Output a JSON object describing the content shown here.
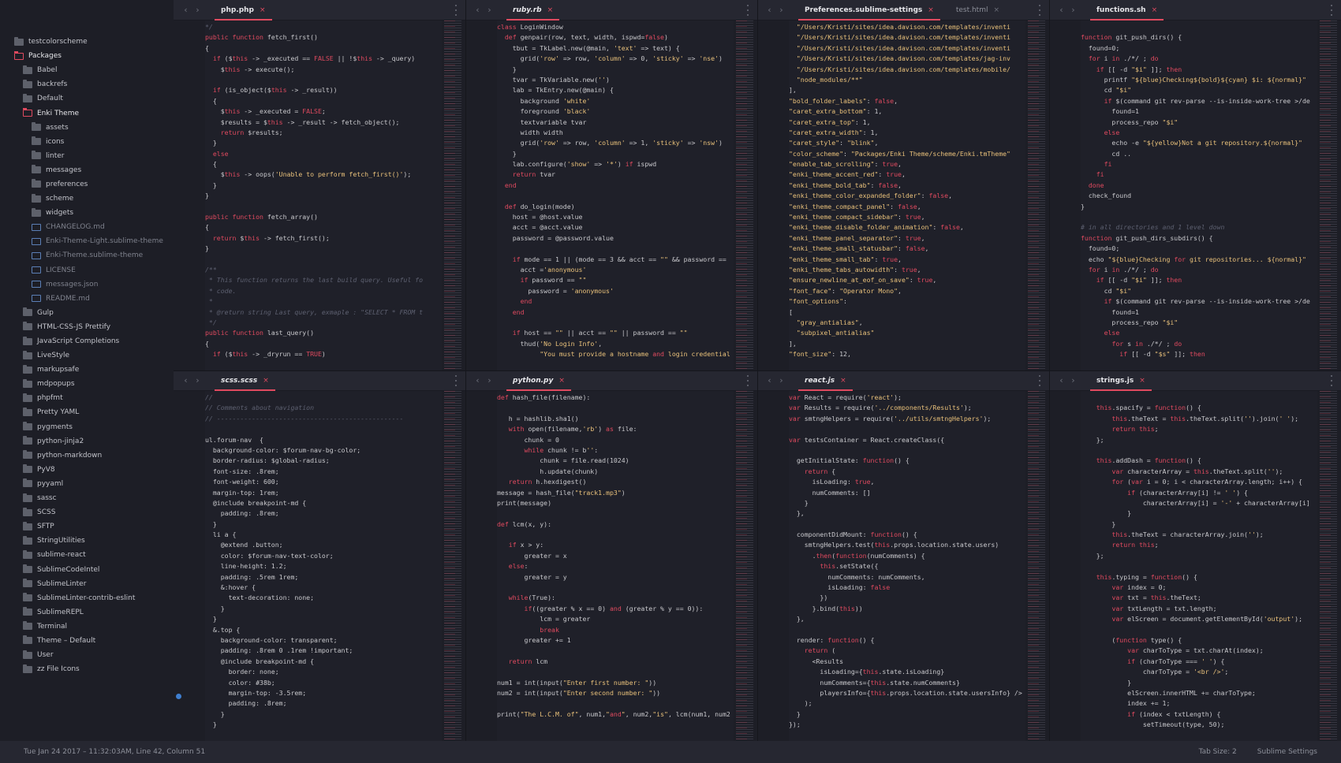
{
  "sidebar": {
    "items": [
      {
        "label": "testcolorscheme",
        "kind": "folder",
        "depth": 0
      },
      {
        "label": "Packages",
        "kind": "folder-open",
        "depth": 0
      },
      {
        "label": "Babel",
        "kind": "folder",
        "depth": 1
      },
      {
        "label": "backrefs",
        "kind": "folder",
        "depth": 1
      },
      {
        "label": "Default",
        "kind": "folder",
        "depth": 1
      },
      {
        "label": "Enki Theme",
        "kind": "folder-open",
        "depth": 1
      },
      {
        "label": "assets",
        "kind": "folder",
        "depth": 2
      },
      {
        "label": "icons",
        "kind": "folder",
        "depth": 2
      },
      {
        "label": "linter",
        "kind": "folder",
        "depth": 2
      },
      {
        "label": "messages",
        "kind": "folder",
        "depth": 2
      },
      {
        "label": "preferences",
        "kind": "folder",
        "depth": 2
      },
      {
        "label": "scheme",
        "kind": "folder",
        "depth": 2
      },
      {
        "label": "widgets",
        "kind": "folder",
        "depth": 2
      },
      {
        "label": "CHANGELOG.md",
        "kind": "file",
        "depth": 2
      },
      {
        "label": "Enki-Theme-Light.sublime-theme",
        "kind": "file",
        "depth": 2
      },
      {
        "label": "Enki-Theme.sublime-theme",
        "kind": "file",
        "depth": 2
      },
      {
        "label": "LICENSE",
        "kind": "file",
        "depth": 2
      },
      {
        "label": "messages.json",
        "kind": "file",
        "depth": 2
      },
      {
        "label": "README.md",
        "kind": "file",
        "depth": 2
      },
      {
        "label": "Gulp",
        "kind": "folder",
        "depth": 1
      },
      {
        "label": "HTML-CSS-JS Prettify",
        "kind": "folder",
        "depth": 1
      },
      {
        "label": "JavaScript Completions",
        "kind": "folder",
        "depth": 1
      },
      {
        "label": "LiveStyle",
        "kind": "folder",
        "depth": 1
      },
      {
        "label": "markupsafe",
        "kind": "folder",
        "depth": 1
      },
      {
        "label": "mdpopups",
        "kind": "folder",
        "depth": 1
      },
      {
        "label": "phpfmt",
        "kind": "folder",
        "depth": 1
      },
      {
        "label": "Pretty YAML",
        "kind": "folder",
        "depth": 1
      },
      {
        "label": "pygments",
        "kind": "folder",
        "depth": 1
      },
      {
        "label": "python-jinja2",
        "kind": "folder",
        "depth": 1
      },
      {
        "label": "python-markdown",
        "kind": "folder",
        "depth": 1
      },
      {
        "label": "PyV8",
        "kind": "folder",
        "depth": 1
      },
      {
        "label": "pyyaml",
        "kind": "folder",
        "depth": 1
      },
      {
        "label": "sassc",
        "kind": "folder",
        "depth": 1
      },
      {
        "label": "SCSS",
        "kind": "folder",
        "depth": 1
      },
      {
        "label": "SFTP",
        "kind": "folder",
        "depth": 1
      },
      {
        "label": "StringUtilities",
        "kind": "folder",
        "depth": 1
      },
      {
        "label": "sublime-react",
        "kind": "folder",
        "depth": 1
      },
      {
        "label": "SublimeCodeIntel",
        "kind": "folder",
        "depth": 1
      },
      {
        "label": "SublimeLinter",
        "kind": "folder",
        "depth": 1
      },
      {
        "label": "SublimeLinter-contrib-eslint",
        "kind": "folder",
        "depth": 1
      },
      {
        "label": "SublimeREPL",
        "kind": "folder",
        "depth": 1
      },
      {
        "label": "Terminal",
        "kind": "folder",
        "depth": 1
      },
      {
        "label": "Theme – Default",
        "kind": "folder",
        "depth": 1
      },
      {
        "label": "User",
        "kind": "folder",
        "depth": 1
      },
      {
        "label": "zz File Icons",
        "kind": "folder",
        "depth": 1
      }
    ]
  },
  "panes": [
    {
      "tabs": [
        {
          "label": "php.php",
          "active": true,
          "italic": false
        }
      ],
      "lines": [
        "*/",
        "public function fetch_first()",
        "{",
        "  if ($this -> _executed == FALSE || !$this -> _query)",
        "    $this -> execute();",
        "",
        "  if (is_object($this -> _result))",
        "  {",
        "    $this -> _executed = FALSE;",
        "    $results = $this -> _result -> fetch_object();",
        "    return $results;",
        "  }",
        "  else",
        "  {",
        "    $this -> oops('Unable to perform fetch_first()');",
        "  }",
        "}",
        "",
        "public function fetch_array()",
        "{",
        "  return $this -> fetch_first();",
        "}",
        "",
        "/**",
        " * This function returns the last build query. Useful fo",
        " * code.",
        " *",
        " * @return string Last query, exmaple : \"SELECT * FROM t",
        " */",
        "public function last_query()",
        "{",
        "  if ($this -> _dryrun == TRUE)"
      ]
    },
    {
      "tabs": [
        {
          "label": "ruby.rb",
          "active": true,
          "italic": true
        }
      ],
      "lines": [
        "class LoginWindow",
        "  def genpair(row, text, width, ispwd=false)",
        "    tbut = TkLabel.new(@main, 'text' => text) {",
        "      grid('row' => row, 'column' => 0, 'sticky' => 'nse')",
        "    }",
        "    tvar = TkVariable.new('')",
        "    lab = TkEntry.new(@main) {",
        "      background 'white'",
        "      foreground 'black'",
        "      textvariable tvar",
        "      width width",
        "      grid('row' => row, 'column' => 1, 'sticky' => 'nsw')",
        "    }",
        "    lab.configure('show' => '*') if ispwd",
        "    return tvar",
        "  end",
        "",
        "  def do_login(mode)",
        "    host = @host.value",
        "    acct = @acct.value",
        "    password = @password.value",
        "",
        "    if mode == 1 || (mode == 3 && acct == \"\" && password ==",
        "      acct ='anonymous'",
        "      if password == \"\"",
        "        password = 'anonymous'",
        "      end",
        "    end",
        "",
        "    if host == \"\" || acct == \"\" || password == \"\"",
        "      thud('No Login Info',",
        "           \"You must provide a hostname and login credential"
      ]
    },
    {
      "tabs": [
        {
          "label": "Preferences.sublime-settings",
          "active": true,
          "italic": false
        },
        {
          "label": "test.html",
          "active": false,
          "italic": false
        }
      ],
      "lines": [
        "  \"/Users/Kristi/sites/idea.davison.com/templates/inventi",
        "  \"/Users/Kristi/sites/idea.davison.com/templates/inventi",
        "  \"/Users/Kristi/sites/idea.davison.com/templates/inventi",
        "  \"/Users/Kristi/sites/idea.davison.com/templates/jag-inv",
        "  \"/Users/Kristi/sites/idea.davison.com/templates/mobile/",
        "  \"node_modules/**\"",
        "],",
        "\"bold_folder_labels\": false,",
        "\"caret_extra_bottom\": 1,",
        "\"caret_extra_top\": 1,",
        "\"caret_extra_width\": 1,",
        "\"caret_style\": \"blink\",",
        "\"color_scheme\": \"Packages/Enki Theme/scheme/Enki.tmTheme\"",
        "\"enable_tab_scrolling\": true,",
        "\"enki_theme_accent_red\": true,",
        "\"enki_theme_bold_tab\": false,",
        "\"enki_theme_color_expanded_folder\": false,",
        "\"enki_theme_compact_panel\": false,",
        "\"enki_theme_compact_sidebar\": true,",
        "\"enki_theme_disable_folder_animation\": false,",
        "\"enki_theme_panel_separator\": true,",
        "\"enki_theme_small_statusbar\": false,",
        "\"enki_theme_small_tab\": true,",
        "\"enki_theme_tabs_autowidth\": true,",
        "\"ensure_newline_at_eof_on_save\": true,",
        "\"font_face\": \"Operator Mono\",",
        "\"font_options\":",
        "[",
        "  \"gray_antialias\",",
        "  \"subpixel_antialias\"",
        "],",
        "\"font_size\": 12,"
      ]
    },
    {
      "tabs": [
        {
          "label": "functions.sh",
          "active": true,
          "italic": false
        }
      ],
      "lines": [
        "",
        "function git_push_dirs() {",
        "  found=0;",
        "  for i in ./*/ ; do",
        "    if [[ -d \"$i\" ]]; then",
        "      printf \"${blue}Checking${bold}${cyan} $i: ${normal}\"",
        "      cd \"$i\"",
        "      if $(command git rev-parse --is-inside-work-tree >/de",
        "        found=1",
        "        process_repo \"$i\"",
        "      else",
        "        echo -e \"${yellow}Not a git repository.${normal}\"",
        "        cd ..",
        "      fi",
        "    fi",
        "  done",
        "  check_found",
        "}",
        "",
        "# in all directories and 1 level down",
        "function git_push_dirs_subdirs() {",
        "  found=0;",
        "  echo \"${blue}Checking for git repositories... ${normal}\"",
        "  for i in ./*/ ; do",
        "    if [[ -d \"$i\" ]]; then",
        "      cd \"$i\"",
        "      if $(command git rev-parse --is-inside-work-tree >/de",
        "        found=1",
        "        process_repo \"$i\"",
        "      else",
        "        for s in ./*/ ; do",
        "          if [[ -d \"$s\" ]]; then"
      ]
    },
    {
      "tabs": [
        {
          "label": "scss.scss",
          "active": true,
          "italic": true
        }
      ],
      "lines": [
        "//",
        "// Comments about navigation",
        "// ------------------------------------------------",
        "",
        "ul.forum-nav  {",
        "  background-color: $forum-nav-bg-color;",
        "  border-radius: $global-radius;",
        "  font-size: .8rem;",
        "  font-weight: 600;",
        "  margin-top: 1rem;",
        "  @include breakpoint-md {",
        "    padding: .8rem;",
        "  }",
        "  li a {",
        "    @extend .button;",
        "    color: $forum-nav-text-color;",
        "    line-height: 1.2;",
        "    padding: .5rem 1rem;",
        "    &:hover {",
        "      text-decoration: none;",
        "    }",
        "  }",
        "  &.top {",
        "    background-color: transparent;",
        "    padding: .8rem 0 .1rem !important;",
        "    @include breakpoint-md {",
        "      border: none;",
        "      color: #38b;",
        "      margin-top: -3.5rem;",
        "      padding: .8rem;",
        "    }",
        "  }"
      ]
    },
    {
      "tabs": [
        {
          "label": "python.py",
          "active": true,
          "italic": true
        }
      ],
      "lines": [
        "def hash_file(filename):",
        "",
        "   h = hashlib.sha1()",
        "   with open(filename,'rb') as file:",
        "       chunk = 0",
        "       while chunk != b'':",
        "           chunk = file.read(1024)",
        "           h.update(chunk)",
        "   return h.hexdigest()",
        "message = hash_file(\"track1.mp3\")",
        "print(message)",
        "",
        "def lcm(x, y):",
        "",
        "   if x > y:",
        "       greater = x",
        "   else:",
        "       greater = y",
        "",
        "   while(True):",
        "       if((greater % x == 0) and (greater % y == 0)):",
        "           lcm = greater",
        "           break",
        "       greater += 1",
        "",
        "   return lcm",
        "",
        "num1 = int(input(\"Enter first number: \"))",
        "num2 = int(input(\"Enter second number: \"))",
        "",
        "print(\"The L.C.M. of\", num1,\"and\", num2,\"is\", lcm(num1, num2"
      ]
    },
    {
      "tabs": [
        {
          "label": "react.js",
          "active": true,
          "italic": true
        }
      ],
      "lines": [
        "var React = require('react');",
        "var Results = require('../components/Results');",
        "var smtngHelpers = require('../utils/smtngHelpers');",
        "",
        "var testsContainer = React.createClass({",
        "",
        "  getInitialState: function() {",
        "    return {",
        "      isLoading: true,",
        "      numComments: []",
        "    }",
        "  },",
        "",
        "  componentDidMount: function() {",
        "    smtngHelpers.test(this.props.location.state.users)",
        "      .then(function(numComments) {",
        "        this.setState({",
        "          numComments: numComments,",
        "          isLoading: false",
        "        })",
        "      }.bind(this))",
        "  },",
        "",
        "  render: function() {",
        "    return (",
        "      <Results",
        "        isLoading={this.state.isLoading}",
        "        numComments={this.state.numComments}",
        "        playersInfo={this.props.location.state.usersInfo} />",
        "    );",
        "  }",
        "});"
      ]
    },
    {
      "tabs": [
        {
          "label": "strings.js",
          "active": true,
          "italic": false
        }
      ],
      "lines": [
        "",
        "    this.spacify = function() {",
        "        this.theText = this.theText.split('').join(' ');",
        "        return this;",
        "    };",
        "",
        "    this.addDash = function() {",
        "        var characterArray = this.theText.split('');",
        "        for (var i = 0; i < characterArray.length; i++) {",
        "            if (characterArray[i] != ' ') {",
        "                characterArray[i] = '-' + characterArray[i]",
        "            }",
        "        }",
        "        this.theText = characterArray.join('');",
        "        return this;",
        "    };",
        "",
        "    this.typing = function() {",
        "        var index = 0;",
        "        var txt = this.theText;",
        "        var txtLength = txt.length;",
        "        var elScreen = document.getElementById('output');",
        "",
        "        (function type() {",
        "            var charToType = txt.charAt(index);",
        "            if (charToType === ' ') {",
        "                charToType = '<br />';",
        "            }",
        "            elScreen.innerHTML += charToType;",
        "            index += 1;",
        "            if (index < txtLength) {",
        "                setTimeout(type, 50);"
      ]
    }
  ],
  "statusbar": {
    "left": "Tue Jan 24 2017 – 11:32:03AM, Line 42, Column 51",
    "tab_size": "Tab Size: 2",
    "syntax": "Sublime Settings"
  },
  "colors": {
    "accent": "#e04a5f",
    "background": "#1f2029",
    "sidebar": "#1d1e26",
    "keyword": "#e04a5f",
    "string": "#e8c07a",
    "comment": "#5d6070"
  }
}
